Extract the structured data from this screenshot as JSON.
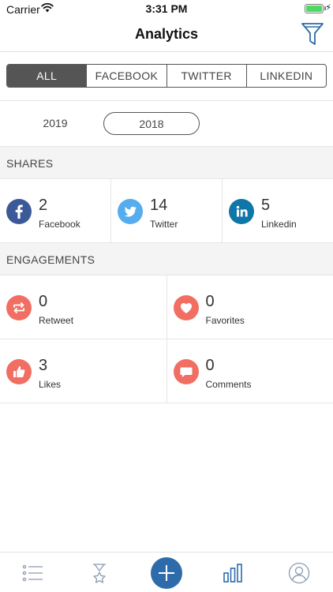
{
  "status_bar": {
    "carrier": "Carrier",
    "time": "3:31 PM"
  },
  "nav": {
    "title": "Analytics"
  },
  "tabs": [
    {
      "label": "ALL",
      "active": true
    },
    {
      "label": "FACEBOOK",
      "active": false
    },
    {
      "label": "TWITTER",
      "active": false
    },
    {
      "label": "LINKEDIN",
      "active": false
    }
  ],
  "years": {
    "option_a": "2019",
    "option_b": "2018",
    "selected": "2018"
  },
  "shares": {
    "header": "SHARES",
    "items": [
      {
        "count": "2",
        "label": "Facebook",
        "icon": "facebook-icon",
        "color": "#3b5998"
      },
      {
        "count": "14",
        "label": "Twitter",
        "icon": "twitter-icon",
        "color": "#55acee"
      },
      {
        "count": "5",
        "label": "Linkedin",
        "icon": "linkedin-icon",
        "color": "#0e76a8"
      }
    ]
  },
  "engagements": {
    "header": "ENGAGEMENTS",
    "items": [
      {
        "count": "0",
        "label": "Retweet",
        "icon": "retweet-icon",
        "color": "#f06f62"
      },
      {
        "count": "0",
        "label": "Favorites",
        "icon": "heart-icon",
        "color": "#f06f62"
      },
      {
        "count": "3",
        "label": "Likes",
        "icon": "thumbs-up-icon",
        "color": "#f06f62"
      },
      {
        "count": "0",
        "label": "Comments",
        "icon": "comment-icon",
        "color": "#f06f62"
      }
    ]
  },
  "colors": {
    "accent": "#2d6bab",
    "segment_active": "#555555",
    "engagement": "#f06f62"
  },
  "tab_bar": [
    "list-icon",
    "hourglass-star-icon",
    "add-icon",
    "bar-chart-icon",
    "profile-icon"
  ]
}
